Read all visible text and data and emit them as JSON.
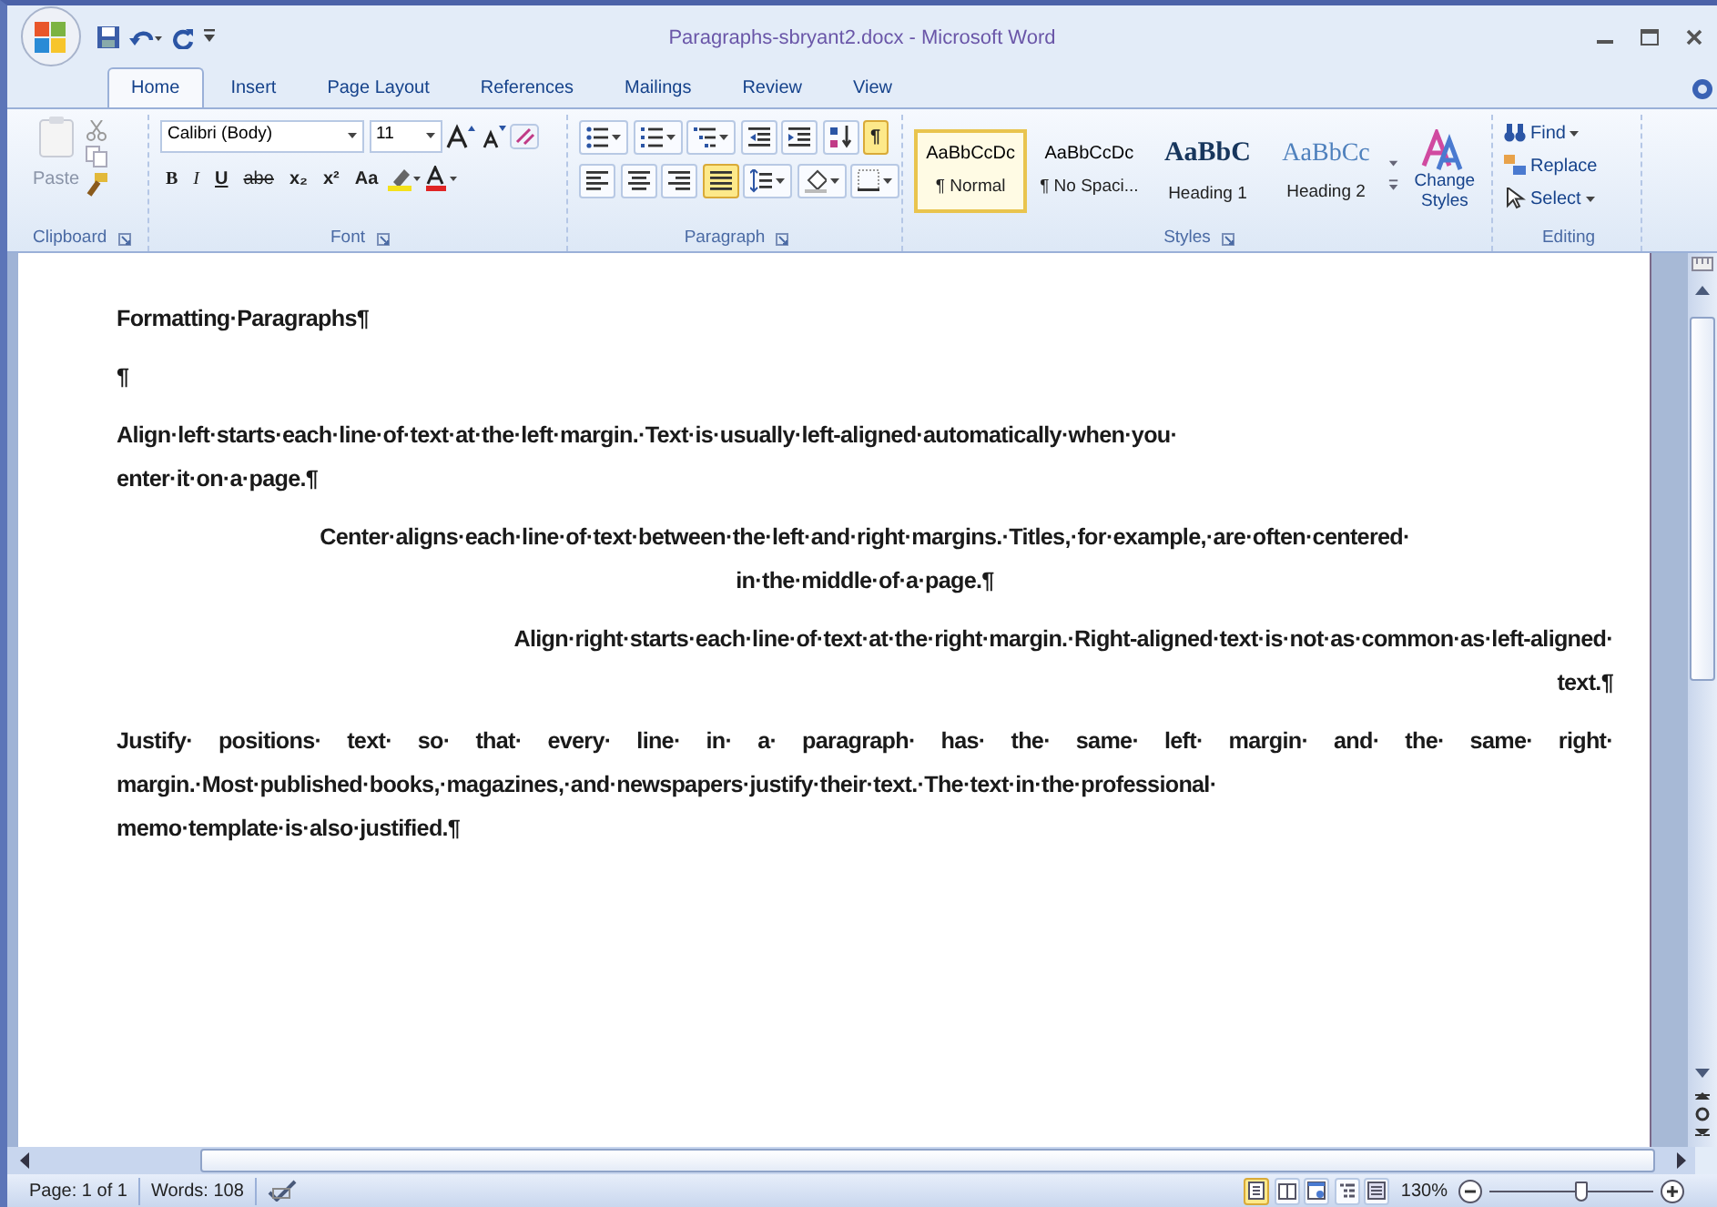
{
  "window": {
    "title": "Paragraphs-sbryant2.docx - Microsoft Word"
  },
  "tabs": [
    {
      "label": "Home",
      "selected": true
    },
    {
      "label": "Insert",
      "selected": false
    },
    {
      "label": "Page Layout",
      "selected": false
    },
    {
      "label": "References",
      "selected": false
    },
    {
      "label": "Mailings",
      "selected": false
    },
    {
      "label": "Review",
      "selected": false
    },
    {
      "label": "View",
      "selected": false
    }
  ],
  "clipboard": {
    "paste_label": "Paste",
    "group_label": "Clipboard"
  },
  "font": {
    "font_name": "Calibri (Body)",
    "font_size": "11",
    "group_label": "Font",
    "buttons": [
      {
        "label": "B",
        "kind": "bold"
      },
      {
        "label": "I",
        "kind": "italic"
      },
      {
        "label": "U",
        "kind": "underline"
      },
      {
        "label": "abe",
        "kind": "strike"
      },
      {
        "label": "x₂",
        "kind": "plain"
      },
      {
        "label": "x²",
        "kind": "plain"
      },
      {
        "label": "Aa",
        "kind": "plain"
      }
    ]
  },
  "paragraph": {
    "group_label": "Paragraph",
    "row1": [
      {
        "kind": "bullets",
        "selected": false
      },
      {
        "kind": "numbering",
        "selected": false
      },
      {
        "kind": "multilevel",
        "selected": false
      },
      {
        "kind": "outdent",
        "selected": false
      },
      {
        "kind": "indent",
        "selected": false
      },
      {
        "kind": "sort",
        "selected": false
      },
      {
        "kind": "marks",
        "label": "¶",
        "selected": true
      }
    ],
    "row2": [
      {
        "kind": "align-left",
        "selected": false
      },
      {
        "kind": "align-center",
        "selected": false
      },
      {
        "kind": "align-right",
        "selected": false
      },
      {
        "kind": "justify",
        "selected": true
      },
      {
        "kind": "spacing",
        "selected": false
      },
      {
        "kind": "shading",
        "selected": false
      },
      {
        "kind": "borders",
        "selected": false
      }
    ]
  },
  "styles": {
    "group_label": "Styles",
    "items": [
      {
        "preview": "AaBbCcDc",
        "name": "¶ Normal",
        "kind": "body",
        "selected": true
      },
      {
        "preview": "AaBbCcDc",
        "name": "¶ No Spaci...",
        "kind": "body",
        "selected": false
      },
      {
        "preview": "AaBbC",
        "name": "Heading 1",
        "kind": "heading1",
        "selected": false
      },
      {
        "preview": "AaBbCc",
        "name": "Heading 2",
        "kind": "heading2",
        "selected": false
      }
    ],
    "change_styles": "Change Styles"
  },
  "editing": {
    "group_label": "Editing",
    "items": [
      {
        "label": "Find",
        "kind": "find",
        "dropdown": true
      },
      {
        "label": "Replace",
        "kind": "replace",
        "dropdown": false
      },
      {
        "label": "Select",
        "kind": "select",
        "dropdown": true
      }
    ]
  },
  "document": {
    "paragraphs": [
      {
        "kind": "left",
        "lines": [
          "Formatting·Paragraphs¶"
        ]
      },
      {
        "kind": "left",
        "lines": [
          "¶"
        ]
      },
      {
        "kind": "left",
        "lines": [
          "Align·left·starts·each·line·of·text·at·the·left·margin.·Text·is·usually·left-aligned·automatically·when·you·",
          "enter·it·on·a·page.¶"
        ]
      },
      {
        "kind": "center",
        "lines": [
          "Center·aligns·each·line·of·text·between·the·left·and·right·margins.·Titles,·for·example,·are·often·centered·",
          "in·the·middle·of·a·page.¶"
        ]
      },
      {
        "kind": "right",
        "lines": [
          "Align·right·starts·each·line·of·text·at·the·right·margin.·Right-aligned·text·is·not·as·common·as·left-aligned·",
          "text.¶"
        ]
      },
      {
        "kind": "justify",
        "lines": [
          "Justify· positions· text· so· that· every· line· in· a· paragraph· has· the· same· left· margin· and· the· same· right·",
          "margin.·Most·published·books,·magazines,·and·newspapers·justify·their·text.·The·text·in·the·professional·",
          "memo·template·is·also·justified.¶"
        ]
      }
    ]
  },
  "status_bar": {
    "page": "Page: 1 of 1",
    "words": "Words: 108",
    "zoom": "130%",
    "zoom_slider": {
      "level": 0.55
    },
    "views": [
      {
        "kind": "print",
        "selected": true
      },
      {
        "kind": "reading",
        "selected": false
      },
      {
        "kind": "web",
        "selected": false
      },
      {
        "kind": "outline",
        "selected": false
      },
      {
        "kind": "draft",
        "selected": false
      }
    ]
  }
}
